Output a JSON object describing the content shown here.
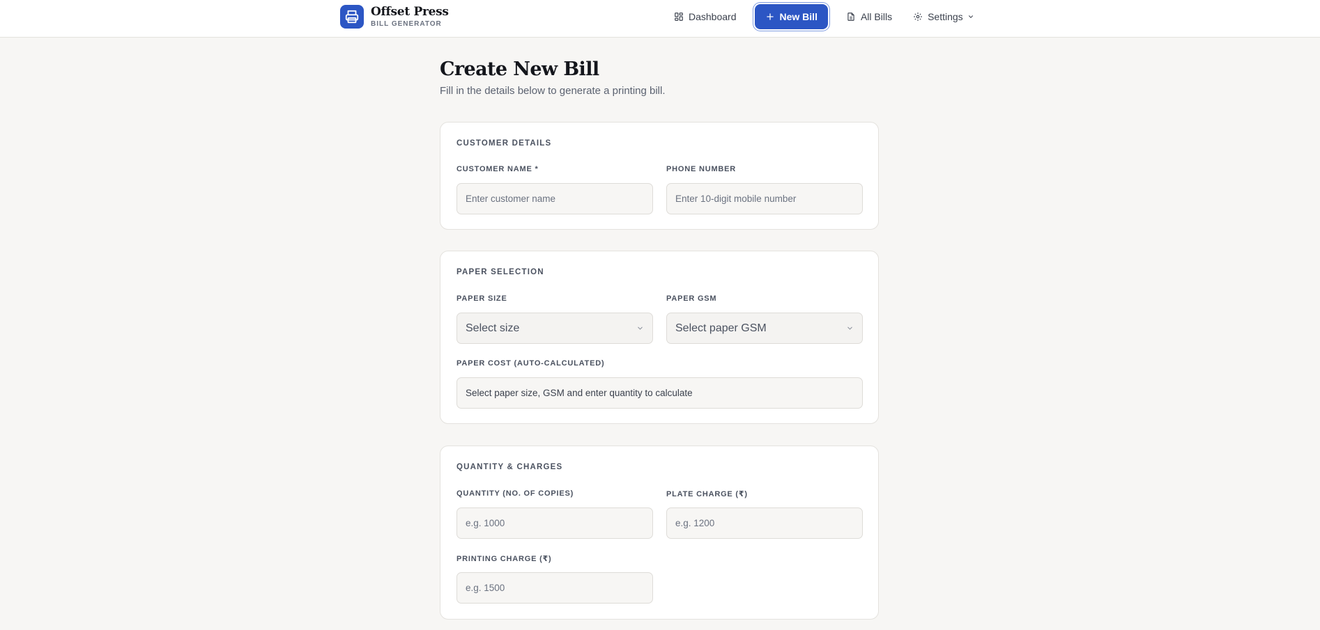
{
  "brand": {
    "name": "Offset Press",
    "subtitle": "BILL GENERATOR"
  },
  "nav": {
    "dashboard": "Dashboard",
    "new_bill": "New Bill",
    "all_bills": "All Bills",
    "settings": "Settings"
  },
  "page": {
    "title": "Create New Bill",
    "subtitle": "Fill in the details below to generate a printing bill."
  },
  "customer": {
    "section_title": "CUSTOMER DETAILS",
    "name_label": "CUSTOMER NAME *",
    "name_placeholder": "Enter customer name",
    "name_value": "",
    "phone_label": "PHONE NUMBER",
    "phone_placeholder": "Enter 10-digit mobile number",
    "phone_value": ""
  },
  "paper": {
    "section_title": "PAPER SELECTION",
    "size_label": "PAPER SIZE",
    "size_selected": "Select size",
    "gsm_label": "PAPER GSM",
    "gsm_selected": "Select paper GSM",
    "cost_label": "PAPER COST (AUTO-CALCULATED)",
    "cost_text": "Select paper size, GSM and enter quantity to calculate"
  },
  "charges": {
    "section_title": "QUANTITY & CHARGES",
    "quantity_label": "QUANTITY (NO. OF COPIES)",
    "quantity_placeholder": "e.g. 1000",
    "plate_label": "PLATE CHARGE (₹)",
    "plate_placeholder": "e.g. 1200",
    "printing_label": "PRINTING CHARGE (₹)",
    "printing_placeholder": "e.g. 1500"
  },
  "colors": {
    "accent": "#2c56c4",
    "background": "#f7f6f4",
    "card": "#ffffff"
  }
}
